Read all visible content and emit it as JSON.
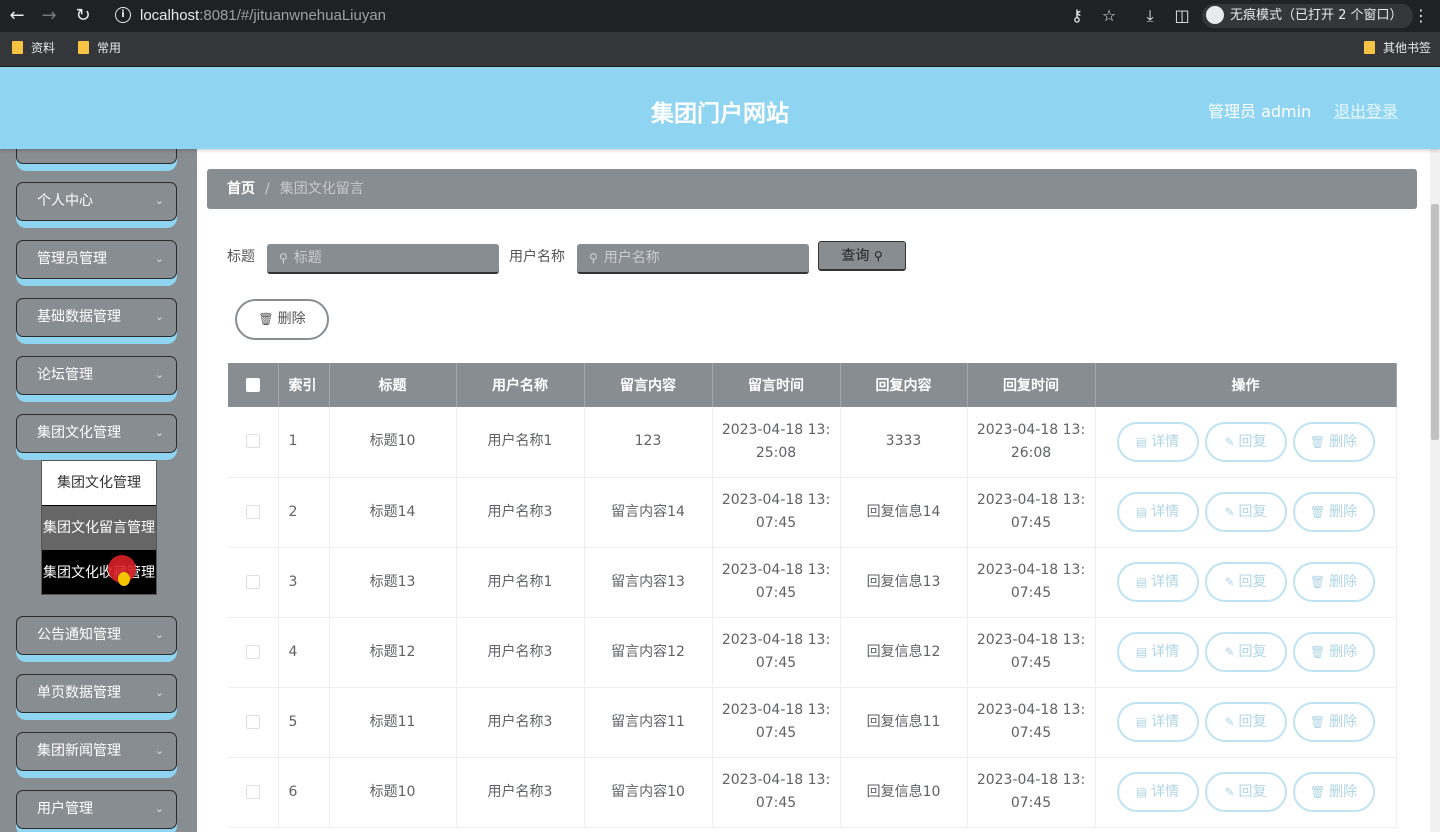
{
  "browser": {
    "url_host": "localhost",
    "url_rest": ":8081/#/jituanwnehuaLiuyan",
    "incognito_label": "无痕模式（已打开 2 个窗口）",
    "bookmarks": [
      "资料",
      "常用"
    ],
    "other_bookmarks": "其他书签"
  },
  "header": {
    "title": "集团门户网站",
    "admin_label": "管理员 admin",
    "logout_label": "退出登录"
  },
  "sidebar": {
    "items": [
      {
        "label": "个人中心"
      },
      {
        "label": "管理员管理"
      },
      {
        "label": "基础数据管理"
      },
      {
        "label": "论坛管理"
      },
      {
        "label": "集团文化管理"
      },
      {
        "label": "公告通知管理"
      },
      {
        "label": "单页数据管理"
      },
      {
        "label": "集团新闻管理"
      },
      {
        "label": "用户管理"
      }
    ],
    "submenu": [
      {
        "label": "集团文化管理"
      },
      {
        "label": "集团文化留言管理"
      },
      {
        "label": "集团文化收藏管理"
      }
    ]
  },
  "breadcrumb": {
    "home": "首页",
    "separator": "/",
    "current": "集团文化留言"
  },
  "filters": {
    "title_label": "标题",
    "title_placeholder": "标题",
    "user_label": "用户名称",
    "user_placeholder": "用户名称",
    "query_label": "查询"
  },
  "actions": {
    "delete_label": "删除"
  },
  "table": {
    "headers": [
      "索引",
      "标题",
      "用户名称",
      "留言内容",
      "留言时间",
      "回复内容",
      "回复时间",
      "操作"
    ],
    "row_buttons": {
      "detail": "详情",
      "reply": "回复",
      "delete": "删除"
    },
    "rows": [
      {
        "index": "1",
        "title": "标题10",
        "user": "用户名称1",
        "content": "123",
        "time_a": "2023-04-18 13:",
        "time_b": "25:08",
        "reply": "3333",
        "rtime_a": "2023-04-18 13:",
        "rtime_b": "26:08"
      },
      {
        "index": "2",
        "title": "标题14",
        "user": "用户名称3",
        "content": "留言内容14",
        "time_a": "2023-04-18 13:",
        "time_b": "07:45",
        "reply": "回复信息14",
        "rtime_a": "2023-04-18 13:",
        "rtime_b": "07:45"
      },
      {
        "index": "3",
        "title": "标题13",
        "user": "用户名称1",
        "content": "留言内容13",
        "time_a": "2023-04-18 13:",
        "time_b": "07:45",
        "reply": "回复信息13",
        "rtime_a": "2023-04-18 13:",
        "rtime_b": "07:45"
      },
      {
        "index": "4",
        "title": "标题12",
        "user": "用户名称3",
        "content": "留言内容12",
        "time_a": "2023-04-18 13:",
        "time_b": "07:45",
        "reply": "回复信息12",
        "rtime_a": "2023-04-18 13:",
        "rtime_b": "07:45"
      },
      {
        "index": "5",
        "title": "标题11",
        "user": "用户名称3",
        "content": "留言内容11",
        "time_a": "2023-04-18 13:",
        "time_b": "07:45",
        "reply": "回复信息11",
        "rtime_a": "2023-04-18 13:",
        "rtime_b": "07:45"
      },
      {
        "index": "6",
        "title": "标题10",
        "user": "用户名称3",
        "content": "留言内容10",
        "time_a": "2023-04-18 13:",
        "time_b": "07:45",
        "reply": "回复信息10",
        "rtime_a": "2023-04-18 13:",
        "rtime_b": "07:45"
      }
    ]
  },
  "colors": {
    "header_bg": "#8fd5f1",
    "sidebar_bg": "#888d92",
    "button_outline": "#bfe3f1"
  }
}
